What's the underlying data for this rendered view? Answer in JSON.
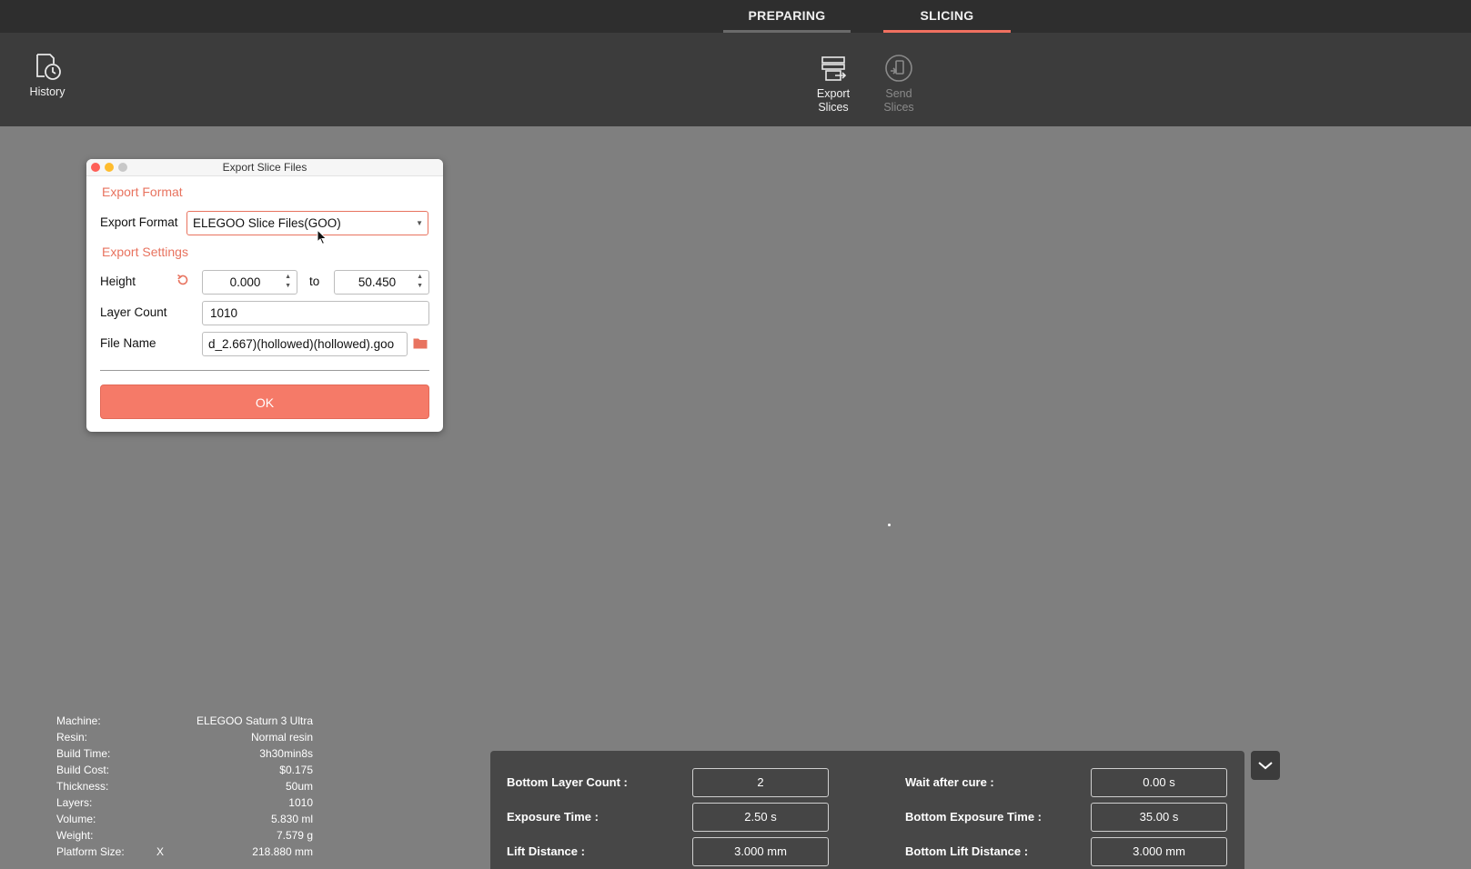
{
  "tabs": {
    "preparing": "PREPARING",
    "slicing": "SLICING",
    "active": "SLICING"
  },
  "toolbar": {
    "history_label": "History",
    "export_label_line1": "Export",
    "export_label_line2": "Slices",
    "send_label_line1": "Send",
    "send_label_line2": "Slices"
  },
  "dialog": {
    "title": "Export Slice Files",
    "section_format": "Export Format",
    "format_label": "Export Format",
    "format_value": "ELEGOO Slice Files(GOO)",
    "section_settings": "Export Settings",
    "height_label": "Height",
    "height_from": "0.000",
    "height_to_word": "to",
    "height_to": "50.450",
    "layer_count_label": "Layer Count",
    "layer_count": "1010",
    "file_name_label": "File Name",
    "file_name": "d_2.667)(hollowed)(hollowed).goo",
    "ok_label": "OK"
  },
  "info": [
    {
      "key": "Machine:",
      "mid": "",
      "value": "ELEGOO Saturn 3 Ultra"
    },
    {
      "key": "Resin:",
      "mid": "",
      "value": "Normal resin"
    },
    {
      "key": "Build Time:",
      "mid": "",
      "value": "3h30min8s"
    },
    {
      "key": "Build Cost:",
      "mid": "",
      "value": "$0.175"
    },
    {
      "key": "Thickness:",
      "mid": "",
      "value": "50um"
    },
    {
      "key": "Layers:",
      "mid": "",
      "value": "1010"
    },
    {
      "key": "Volume:",
      "mid": "",
      "value": "5.830 ml"
    },
    {
      "key": "Weight:",
      "mid": "",
      "value": "7.579 g"
    },
    {
      "key": "Platform Size:",
      "mid": "X",
      "value": "218.880 mm"
    }
  ],
  "params": {
    "bottom_layer_count_label": "Bottom Layer Count :",
    "bottom_layer_count": "2",
    "wait_after_cure_label": "Wait after cure :",
    "wait_after_cure": "0.00 s",
    "exposure_time_label": "Exposure Time :",
    "exposure_time": "2.50 s",
    "bottom_exposure_time_label": "Bottom Exposure Time :",
    "bottom_exposure_time": "35.00 s",
    "lift_distance_label": "Lift Distance :",
    "lift_distance": "3.000 mm",
    "bottom_lift_distance_label": "Bottom Lift Distance :",
    "bottom_lift_distance": "3.000 mm"
  },
  "colors": {
    "accent": "#f57a68",
    "toolbar": "#3c3c3c",
    "topbar": "#2e2e2e",
    "canvas": "#7f7f7f"
  }
}
